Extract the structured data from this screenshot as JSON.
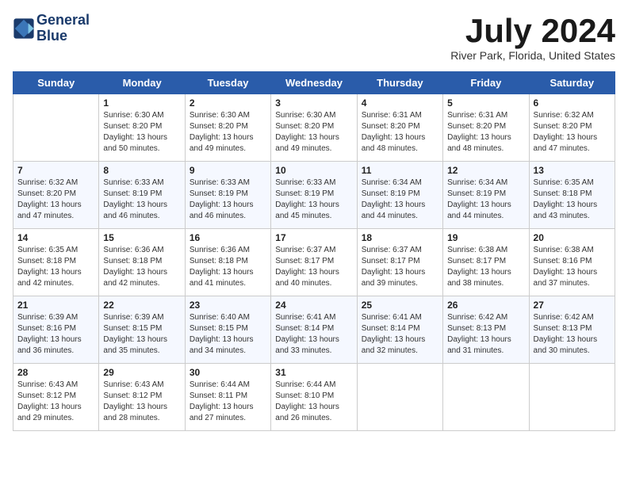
{
  "header": {
    "logo_line1": "General",
    "logo_line2": "Blue",
    "month_title": "July 2024",
    "location": "River Park, Florida, United States"
  },
  "days_of_week": [
    "Sunday",
    "Monday",
    "Tuesday",
    "Wednesday",
    "Thursday",
    "Friday",
    "Saturday"
  ],
  "weeks": [
    [
      {
        "day": "",
        "content": ""
      },
      {
        "day": "1",
        "content": "Sunrise: 6:30 AM\nSunset: 8:20 PM\nDaylight: 13 hours\nand 50 minutes."
      },
      {
        "day": "2",
        "content": "Sunrise: 6:30 AM\nSunset: 8:20 PM\nDaylight: 13 hours\nand 49 minutes."
      },
      {
        "day": "3",
        "content": "Sunrise: 6:30 AM\nSunset: 8:20 PM\nDaylight: 13 hours\nand 49 minutes."
      },
      {
        "day": "4",
        "content": "Sunrise: 6:31 AM\nSunset: 8:20 PM\nDaylight: 13 hours\nand 48 minutes."
      },
      {
        "day": "5",
        "content": "Sunrise: 6:31 AM\nSunset: 8:20 PM\nDaylight: 13 hours\nand 48 minutes."
      },
      {
        "day": "6",
        "content": "Sunrise: 6:32 AM\nSunset: 8:20 PM\nDaylight: 13 hours\nand 47 minutes."
      }
    ],
    [
      {
        "day": "7",
        "content": "Sunrise: 6:32 AM\nSunset: 8:20 PM\nDaylight: 13 hours\nand 47 minutes."
      },
      {
        "day": "8",
        "content": "Sunrise: 6:33 AM\nSunset: 8:19 PM\nDaylight: 13 hours\nand 46 minutes."
      },
      {
        "day": "9",
        "content": "Sunrise: 6:33 AM\nSunset: 8:19 PM\nDaylight: 13 hours\nand 46 minutes."
      },
      {
        "day": "10",
        "content": "Sunrise: 6:33 AM\nSunset: 8:19 PM\nDaylight: 13 hours\nand 45 minutes."
      },
      {
        "day": "11",
        "content": "Sunrise: 6:34 AM\nSunset: 8:19 PM\nDaylight: 13 hours\nand 44 minutes."
      },
      {
        "day": "12",
        "content": "Sunrise: 6:34 AM\nSunset: 8:19 PM\nDaylight: 13 hours\nand 44 minutes."
      },
      {
        "day": "13",
        "content": "Sunrise: 6:35 AM\nSunset: 8:18 PM\nDaylight: 13 hours\nand 43 minutes."
      }
    ],
    [
      {
        "day": "14",
        "content": "Sunrise: 6:35 AM\nSunset: 8:18 PM\nDaylight: 13 hours\nand 42 minutes."
      },
      {
        "day": "15",
        "content": "Sunrise: 6:36 AM\nSunset: 8:18 PM\nDaylight: 13 hours\nand 42 minutes."
      },
      {
        "day": "16",
        "content": "Sunrise: 6:36 AM\nSunset: 8:18 PM\nDaylight: 13 hours\nand 41 minutes."
      },
      {
        "day": "17",
        "content": "Sunrise: 6:37 AM\nSunset: 8:17 PM\nDaylight: 13 hours\nand 40 minutes."
      },
      {
        "day": "18",
        "content": "Sunrise: 6:37 AM\nSunset: 8:17 PM\nDaylight: 13 hours\nand 39 minutes."
      },
      {
        "day": "19",
        "content": "Sunrise: 6:38 AM\nSunset: 8:17 PM\nDaylight: 13 hours\nand 38 minutes."
      },
      {
        "day": "20",
        "content": "Sunrise: 6:38 AM\nSunset: 8:16 PM\nDaylight: 13 hours\nand 37 minutes."
      }
    ],
    [
      {
        "day": "21",
        "content": "Sunrise: 6:39 AM\nSunset: 8:16 PM\nDaylight: 13 hours\nand 36 minutes."
      },
      {
        "day": "22",
        "content": "Sunrise: 6:39 AM\nSunset: 8:15 PM\nDaylight: 13 hours\nand 35 minutes."
      },
      {
        "day": "23",
        "content": "Sunrise: 6:40 AM\nSunset: 8:15 PM\nDaylight: 13 hours\nand 34 minutes."
      },
      {
        "day": "24",
        "content": "Sunrise: 6:41 AM\nSunset: 8:14 PM\nDaylight: 13 hours\nand 33 minutes."
      },
      {
        "day": "25",
        "content": "Sunrise: 6:41 AM\nSunset: 8:14 PM\nDaylight: 13 hours\nand 32 minutes."
      },
      {
        "day": "26",
        "content": "Sunrise: 6:42 AM\nSunset: 8:13 PM\nDaylight: 13 hours\nand 31 minutes."
      },
      {
        "day": "27",
        "content": "Sunrise: 6:42 AM\nSunset: 8:13 PM\nDaylight: 13 hours\nand 30 minutes."
      }
    ],
    [
      {
        "day": "28",
        "content": "Sunrise: 6:43 AM\nSunset: 8:12 PM\nDaylight: 13 hours\nand 29 minutes."
      },
      {
        "day": "29",
        "content": "Sunrise: 6:43 AM\nSunset: 8:12 PM\nDaylight: 13 hours\nand 28 minutes."
      },
      {
        "day": "30",
        "content": "Sunrise: 6:44 AM\nSunset: 8:11 PM\nDaylight: 13 hours\nand 27 minutes."
      },
      {
        "day": "31",
        "content": "Sunrise: 6:44 AM\nSunset: 8:10 PM\nDaylight: 13 hours\nand 26 minutes."
      },
      {
        "day": "",
        "content": ""
      },
      {
        "day": "",
        "content": ""
      },
      {
        "day": "",
        "content": ""
      }
    ]
  ]
}
